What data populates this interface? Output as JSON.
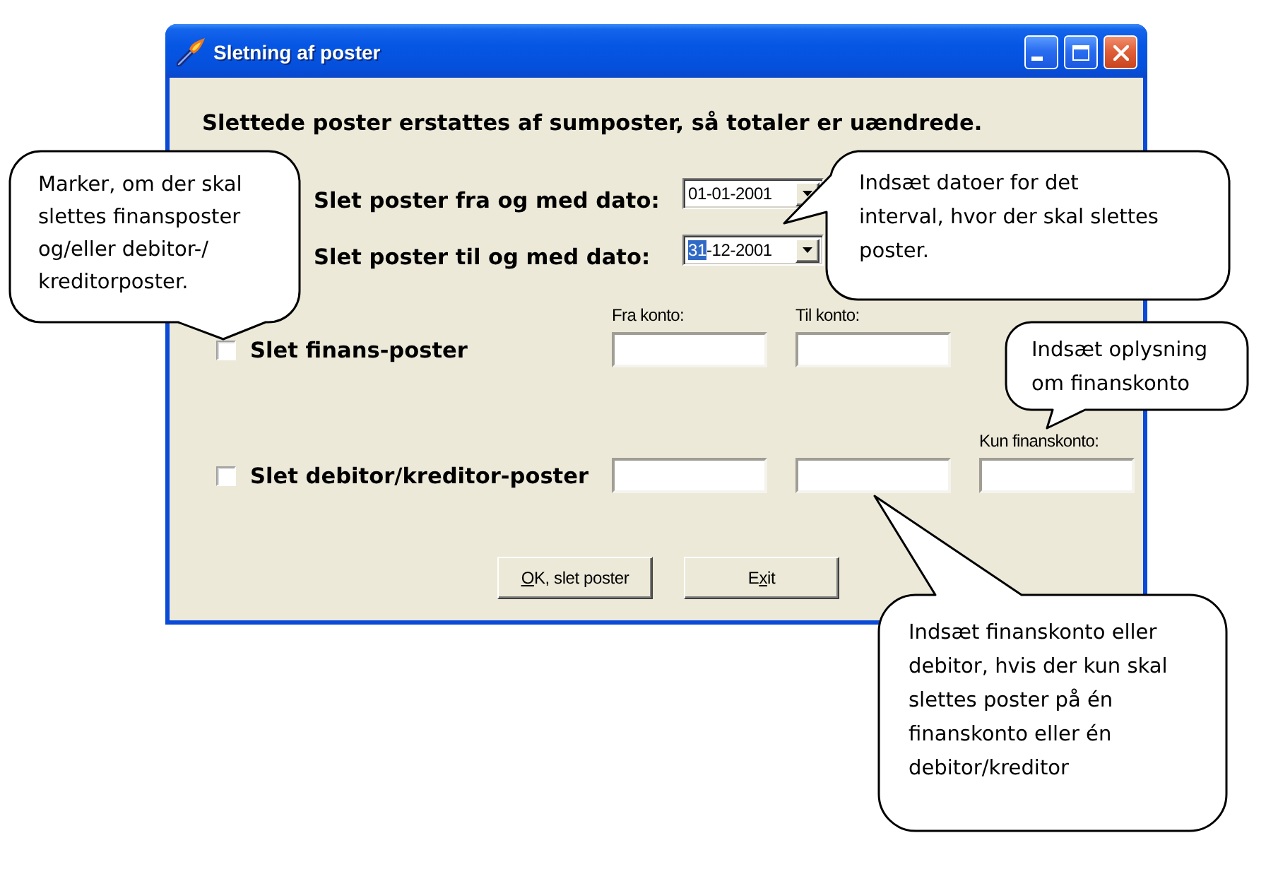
{
  "window": {
    "title": "Sletning af poster"
  },
  "intro": "Slettede poster erstattes af sumposter, så totaler er uændrede.",
  "date_rows": [
    {
      "label": "Slet poster fra og med dato:",
      "segments": [
        {
          "text": "01",
          "selected": false
        },
        {
          "text": "-01-2001",
          "selected": false
        }
      ]
    },
    {
      "label": "Slet poster til og med dato:",
      "segments": [
        {
          "text": "31",
          "selected": true
        },
        {
          "text": "-12-2001",
          "selected": false
        }
      ]
    }
  ],
  "account_rows": [
    {
      "label": "Slet finans-poster",
      "checked": false,
      "fields": [
        {
          "kind": "text",
          "label": "Fra konto:"
        },
        {
          "kind": "text",
          "label": "Til konto:"
        }
      ]
    },
    {
      "label": "Slet debitor/kreditor-poster",
      "checked": false,
      "fields": [
        {
          "kind": "text"
        },
        {
          "kind": "text"
        },
        {
          "kind": "text",
          "label": "Kun finanskonto:"
        }
      ]
    }
  ],
  "buttons": [
    {
      "segments": [
        {
          "text": "O",
          "underlined": true
        },
        {
          "text": "K, slet poster",
          "underlined": false
        }
      ]
    },
    {
      "segments": [
        {
          "text": "E",
          "underlined": false
        },
        {
          "text": "x",
          "underlined": true
        },
        {
          "text": "it",
          "underlined": false
        }
      ]
    }
  ],
  "callouts": [
    {
      "lines": [
        "Marker, om der skal",
        "slettes finansposter",
        "og/eller debitor-/",
        "kreditorposter."
      ]
    },
    {
      "lines": [
        "Indsæt datoer for det",
        "interval, hvor der skal slettes",
        "poster."
      ]
    },
    {
      "lines": [
        "Indsæt oplysning",
        "om finanskonto"
      ]
    },
    {
      "lines": [
        "Indsæt finanskonto eller",
        "debitor, hvis der kun skal",
        "slettes poster på én",
        "finanskonto eller én",
        "debitor/kreditor"
      ]
    }
  ]
}
